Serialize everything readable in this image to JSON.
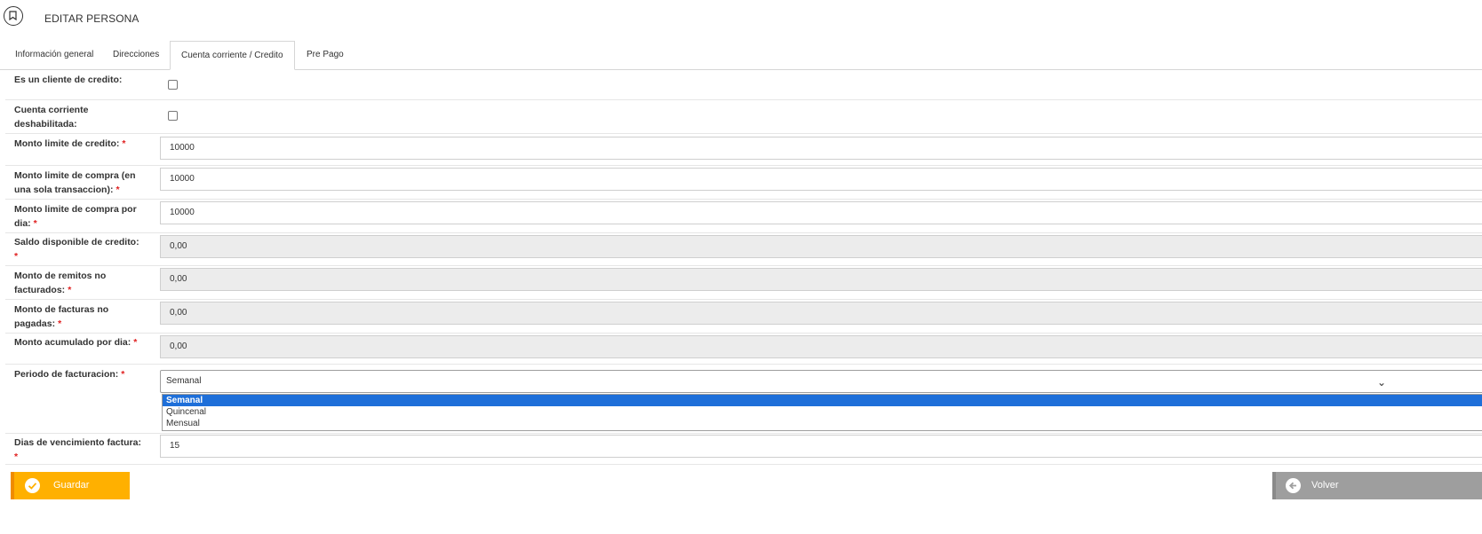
{
  "header": {
    "title": "EDITAR PERSONA"
  },
  "tabs": [
    {
      "label": "Información general",
      "active": false
    },
    {
      "label": "Direcciones",
      "active": false
    },
    {
      "label": "Cuenta corriente / Credito",
      "active": true
    },
    {
      "label": "Pre Pago",
      "active": false
    }
  ],
  "form": {
    "es_cliente_credito": {
      "label": "Es un cliente de credito:",
      "checked": false
    },
    "cuenta_deshabilitada": {
      "label_line1": "Cuenta corriente",
      "label_line2": "deshabilitada:",
      "checked": false
    },
    "monto_limite_credito": {
      "label": "Monto limite de credito:",
      "value": "10000"
    },
    "monto_limite_compra": {
      "label_line1": "Monto limite de compra (en",
      "label_line2": "una sola transaccion):",
      "value": "10000"
    },
    "monto_limite_dia": {
      "label_line1": "Monto limite de compra por",
      "label_line2": "dia:",
      "value": "10000"
    },
    "saldo_disponible": {
      "label": "Saldo disponible de credito:",
      "value": "0,00"
    },
    "monto_remitos": {
      "label_line1": "Monto de remitos no",
      "label_line2": "facturados:",
      "value": "0,00"
    },
    "monto_facturas": {
      "label_line1": "Monto de facturas no",
      "label_line2": "pagadas:",
      "value": "0,00"
    },
    "monto_acumulado": {
      "label": "Monto acumulado por dia:",
      "value": "0,00"
    },
    "periodo": {
      "label": "Periodo de facturacion:",
      "selected": "Semanal",
      "options": [
        "Semanal",
        "Quincenal",
        "Mensual"
      ]
    },
    "dias_vencimiento": {
      "label": "Dias de vencimiento factura:",
      "value": "15"
    },
    "required_mark": "*"
  },
  "buttons": {
    "save": "Guardar",
    "back": "Volver"
  },
  "colors": {
    "save": "#ffb000",
    "back": "#9e9e9e",
    "selected_option": "#1e6fd9",
    "required": "#e02020"
  }
}
